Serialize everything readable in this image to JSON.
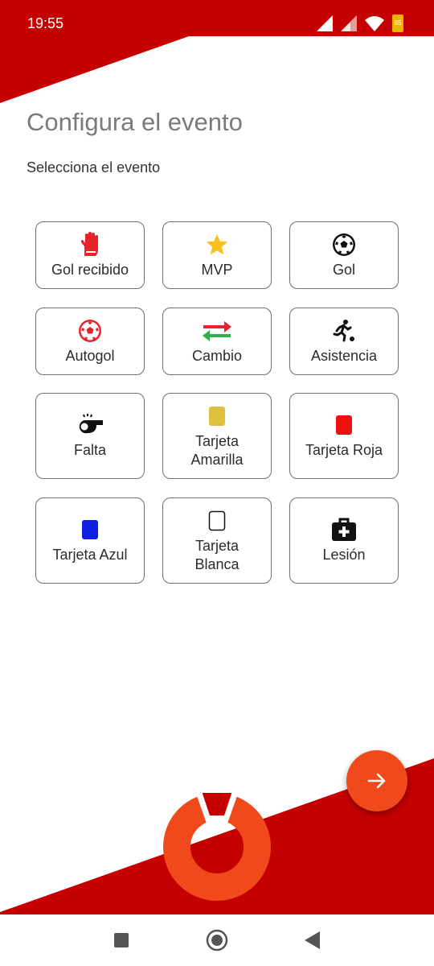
{
  "status_bar": {
    "time": "19:55",
    "battery_level": "85"
  },
  "header": {
    "title": "Configura el evento",
    "subtitle": "Selecciona el evento"
  },
  "events": [
    {
      "label": "Gol recibido",
      "icon": "goalkeeper-glove-icon"
    },
    {
      "label": "MVP",
      "icon": "star-icon"
    },
    {
      "label": "Gol",
      "icon": "soccer-ball-icon"
    },
    {
      "label": "Autogol",
      "icon": "red-soccer-ball-icon"
    },
    {
      "label": "Cambio",
      "icon": "substitution-arrows-icon"
    },
    {
      "label": "Asistencia",
      "icon": "kicking-player-icon"
    },
    {
      "label": "Falta",
      "icon": "whistle-icon"
    },
    {
      "label": "Tarjeta Amarilla",
      "icon": "yellow-card-icon"
    },
    {
      "label": "Tarjeta Roja",
      "icon": "red-card-icon"
    },
    {
      "label": "Tarjeta Azul",
      "icon": "blue-card-icon"
    },
    {
      "label": "Tarjeta Blanca",
      "icon": "white-card-icon"
    },
    {
      "label": "Lesión",
      "icon": "first-aid-kit-icon"
    }
  ],
  "fab": {
    "icon": "arrow-right-icon"
  },
  "colors": {
    "brand_red": "#c40000",
    "accent_orange": "#f04a1c",
    "yellow_card": "#e0c040",
    "red_card": "#ee1111",
    "blue_card": "#1020e0"
  },
  "nav": {
    "icons": [
      "recents-square-icon",
      "home-circle-icon",
      "back-triangle-icon"
    ]
  }
}
